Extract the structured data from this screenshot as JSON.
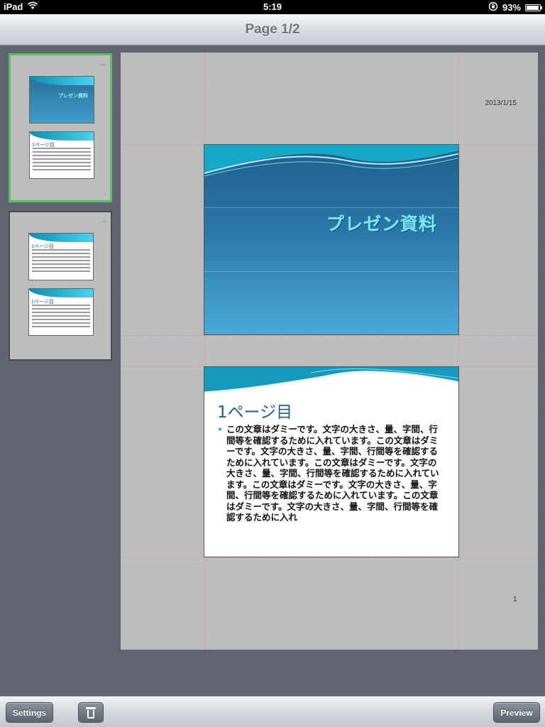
{
  "status_bar": {
    "device": "iPad",
    "time": "5:19",
    "battery_percent": "93%",
    "battery_level": 0.93,
    "icons": [
      "wifi-icon",
      "rotation-lock-icon",
      "battery-icon"
    ]
  },
  "nav_bar": {
    "title": "Page 1/2"
  },
  "document_page": {
    "date": "2013/1/15",
    "page_number": "1",
    "slide1": {
      "title": "プレゼン資料"
    },
    "slide2": {
      "heading": "1ページ目",
      "bullet": "この文章はダミーです。文字の大きさ、量、字間、行間等を確認するために入れています。この文章はダミーです。文字の大きさ、量、字間、行間等を確認するために入れています。この文章はダミーです。文字の大きさ、量、字間、行間等を確認するために入れています。この文章はダミーです。文字の大きさ、量、字間、行間等を確認するために入れています。この文章はダミーです。文字の大きさ、量、字間、行間等を確認するために入れ"
    }
  },
  "sidebar": {
    "pages": [
      {
        "selected": true
      },
      {
        "selected": false
      }
    ]
  },
  "toolbar": {
    "settings_label": "Settings",
    "preview_label": "Preview",
    "trash_icon": "trash-icon"
  },
  "colors": {
    "selection": "#59c15b",
    "slide_title": "#7ce9f4",
    "slide_heading": "#1c5f8e",
    "guide_line": "#d99a9a"
  }
}
